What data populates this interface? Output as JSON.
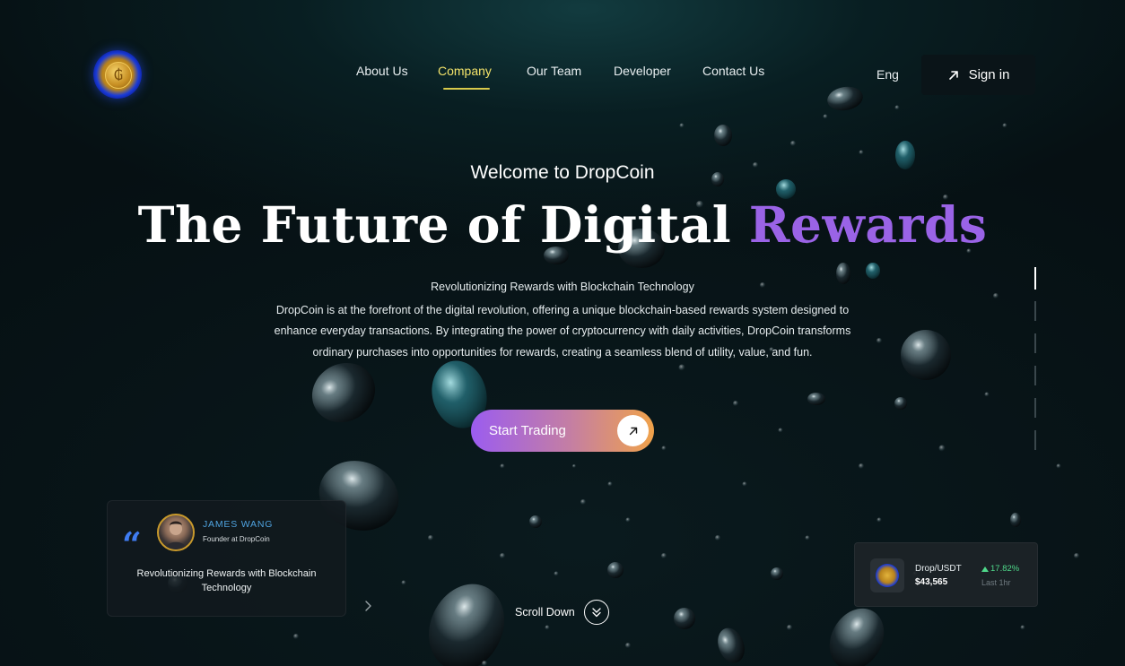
{
  "header": {
    "logo_name": "dropcoin-logo",
    "logo_glyph": "₲",
    "nav": [
      {
        "label": "About Us",
        "active": false
      },
      {
        "label": "Company",
        "active": true
      },
      {
        "label": "Our Team",
        "active": false
      },
      {
        "label": "Developer",
        "active": false
      },
      {
        "label": "Contact Us",
        "active": false
      }
    ],
    "language": "Eng",
    "sign_in_label": "Sign in"
  },
  "hero": {
    "welcome": "Welcome to DropCoin",
    "title_main": "The Future of Digital ",
    "title_accent": "Rewards",
    "subheading": "Revolutionizing Rewards with Blockchain Technology",
    "description": "DropCoin is at the forefront of the digital revolution, offering a unique blockchain-based rewards system designed to enhance everyday transactions. By integrating the power of cryptocurrency with daily activities, DropCoin transforms ordinary purchases into opportunities for rewards, creating a seamless blend of utility, value, and fun.",
    "cta_label": "Start Trading"
  },
  "testimonial": {
    "name": "JAMES WANG",
    "role": "Founder at DropCoin",
    "quote": "Revolutionizing Rewards with Blockchain Technology"
  },
  "scroll": {
    "label": "Scroll Down"
  },
  "ticker": {
    "pair": "Drop/USDT",
    "price": "$43,565",
    "change": "17.82%",
    "period": "Last 1hr"
  },
  "colors": {
    "accent_purple": "#9a63e6",
    "nav_active": "#f3e36a",
    "cta_gradient_start": "#9b5cf0",
    "cta_gradient_end": "#f0a24a",
    "name_blue": "#4fa3e0",
    "positive_green": "#4fd98a"
  }
}
